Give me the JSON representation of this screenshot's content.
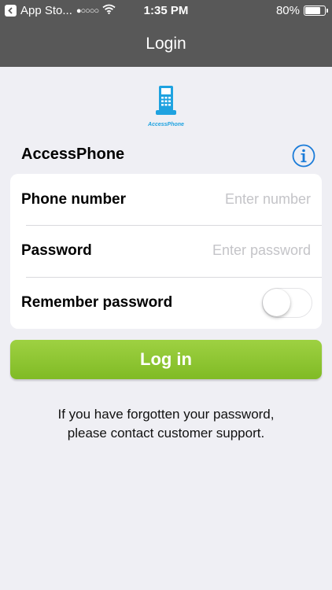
{
  "status_bar": {
    "back_app": "App Sto...",
    "signal": "●○○○○",
    "time": "1:35 PM",
    "battery_text": "80%",
    "battery_level": 0.8
  },
  "nav": {
    "title": "Login"
  },
  "logo": {
    "text": "AccessPhone",
    "icon": "phone-logo-icon",
    "color": "#1ea2e0"
  },
  "section": {
    "title": "AccessPhone",
    "info_icon": "info-icon"
  },
  "form": {
    "phone_label": "Phone number",
    "phone_value": "",
    "phone_placeholder": "Enter number",
    "password_label": "Password",
    "password_value": "",
    "password_placeholder": "Enter password",
    "remember_label": "Remember password",
    "remember_on": false
  },
  "login_button": {
    "label": "Log in",
    "color": "#8dc63f"
  },
  "help_text": {
    "line1": "If you have forgotten your password,",
    "line2": "please contact customer support."
  },
  "colors": {
    "header_bg": "#585858",
    "page_bg": "#efeff4",
    "accent": "#1a7bd8"
  }
}
